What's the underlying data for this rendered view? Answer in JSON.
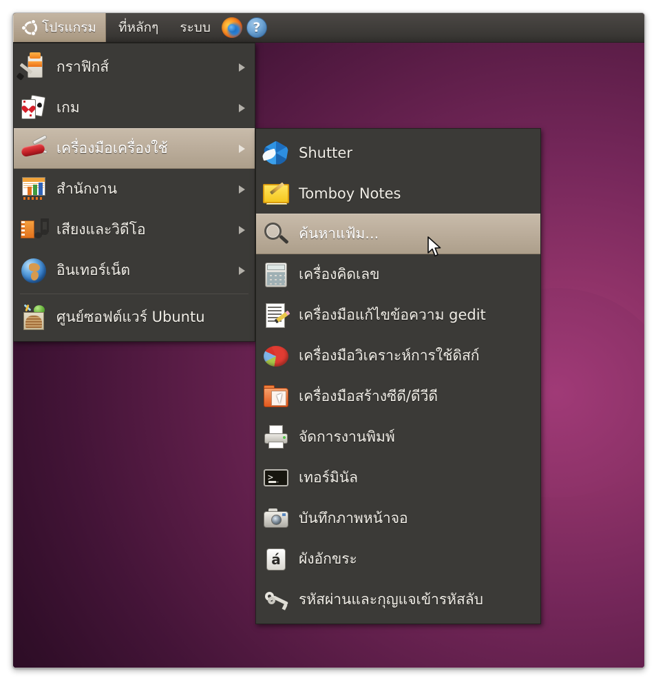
{
  "panel": {
    "applications_label": "โปรแกรม",
    "places_label": "ที่หลักๆ",
    "system_label": "ระบบ",
    "firefox_icon": "firefox-icon",
    "help_icon": "help-icon",
    "logo_icon": "ubuntu-logo-icon"
  },
  "applications_menu": {
    "items": [
      {
        "label": "กราฟิกส์",
        "icon": "graphics-icon",
        "has_submenu": true,
        "highlighted": false
      },
      {
        "label": "เกม",
        "icon": "games-icon",
        "has_submenu": true,
        "highlighted": false
      },
      {
        "label": "เครื่องมือเครื่องใช้",
        "icon": "accessories-icon",
        "has_submenu": true,
        "highlighted": true
      },
      {
        "label": "สำนักงาน",
        "icon": "office-icon",
        "has_submenu": true,
        "highlighted": false
      },
      {
        "label": "เสียงและวิดีโอ",
        "icon": "sound-video-icon",
        "has_submenu": true,
        "highlighted": false
      },
      {
        "label": "อินเทอร์เน็ต",
        "icon": "internet-icon",
        "has_submenu": true,
        "highlighted": false
      },
      {
        "label": "ศูนย์ซอฟต์แวร์ Ubuntu",
        "icon": "ubuntu-software-center-icon",
        "has_submenu": false,
        "highlighted": false
      }
    ]
  },
  "accessories_submenu": {
    "items": [
      {
        "label": "Shutter",
        "icon": "shutter-icon",
        "highlighted": false
      },
      {
        "label": "Tomboy Notes",
        "icon": "tomboy-notes-icon",
        "highlighted": false
      },
      {
        "label": "ค้นหาแฟ้ม...",
        "icon": "search-files-icon",
        "highlighted": true
      },
      {
        "label": "เครื่องคิดเลข",
        "icon": "calculator-icon",
        "highlighted": false
      },
      {
        "label": "เครื่องมือแก้ไขข้อความ gedit",
        "icon": "gedit-text-editor-icon",
        "highlighted": false
      },
      {
        "label": "เครื่องมือวิเคราะห์การใช้ดิสก์",
        "icon": "disk-usage-analyzer-icon",
        "highlighted": false
      },
      {
        "label": "เครื่องมือสร้างซีดี/ดีวีดี",
        "icon": "cd-dvd-creator-icon",
        "highlighted": false
      },
      {
        "label": "จัดการงานพิมพ์",
        "icon": "print-manager-icon",
        "highlighted": false
      },
      {
        "label": "เทอร์มินัล",
        "icon": "terminal-icon",
        "highlighted": false
      },
      {
        "label": "บันทึกภาพหน้าจอ",
        "icon": "screenshot-icon",
        "highlighted": false
      },
      {
        "label": "ผังอักขระ",
        "icon": "character-map-icon",
        "highlighted": false,
        "glyph": "á"
      },
      {
        "label": "รหัสผ่านและกุญแจเข้ารหัสลับ",
        "icon": "passwords-and-keys-icon",
        "highlighted": false
      }
    ]
  },
  "terminal_icon_prompt": ">_",
  "help_icon_glyph": "?",
  "colors": {
    "panel_bg": "#423f3c",
    "menu_bg": "#3b3a37",
    "menu_text": "#f0ede6",
    "highlight_bg": "#bcae9c",
    "desktop_accent": "#8d3268"
  }
}
